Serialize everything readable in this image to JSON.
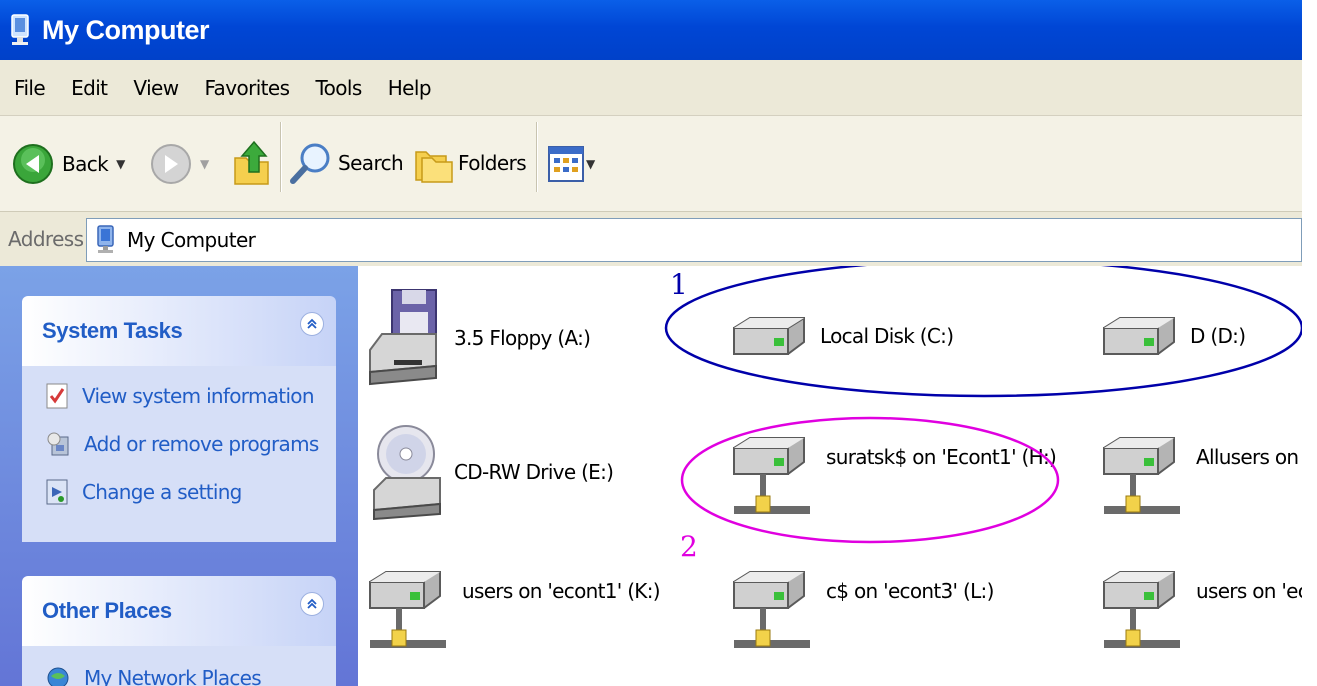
{
  "window": {
    "title": "My Computer"
  },
  "menu": [
    "File",
    "Edit",
    "View",
    "Favorites",
    "Tools",
    "Help"
  ],
  "toolbar": {
    "back": "Back",
    "search": "Search",
    "folders": "Folders"
  },
  "address": {
    "label": "Address",
    "value": "My Computer"
  },
  "system_tasks": {
    "title": "System Tasks",
    "items": [
      "View system information",
      "Add or remove programs",
      "Change a setting"
    ]
  },
  "other_places": {
    "title": "Other Places",
    "items": [
      "My Network Places"
    ]
  },
  "drives": [
    {
      "label": "3.5 Floppy (A:)",
      "icon": "floppy-drive-icon"
    },
    {
      "label": "Local Disk (C:)",
      "icon": "hard-disk-icon"
    },
    {
      "label": "D (D:)",
      "icon": "hard-disk-icon"
    },
    {
      "label": "CD-RW Drive (E:)",
      "icon": "cd-drive-icon"
    },
    {
      "label": "suratsk$ on 'Econt1' (H:)",
      "icon": "network-drive-icon"
    },
    {
      "label": "Allusers on 'Ec",
      "icon": "network-drive-icon"
    },
    {
      "label": "users on 'econt1' (K:)",
      "icon": "network-drive-icon"
    },
    {
      "label": "c$ on 'econt3' (L:)",
      "icon": "network-drive-icon"
    },
    {
      "label": "users on 'econ",
      "icon": "network-drive-icon"
    }
  ],
  "annotations": [
    {
      "text": "1",
      "color": "#0000aa"
    },
    {
      "text": "2",
      "color": "#e000e0"
    }
  ]
}
